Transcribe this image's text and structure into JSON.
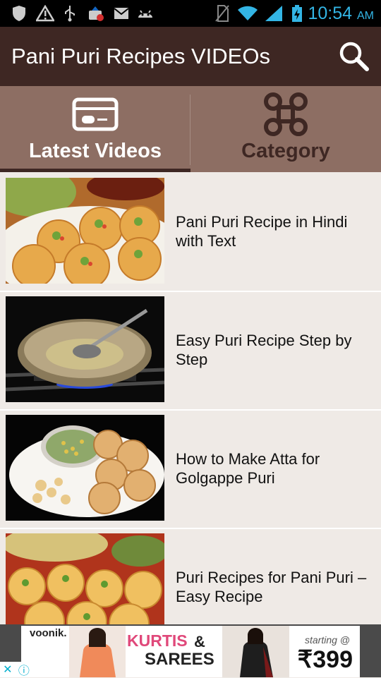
{
  "status_bar": {
    "icons": [
      "shield-icon",
      "warning-icon",
      "usb-icon",
      "app-update-icon",
      "mail-icon",
      "android-icon",
      "no-sim-icon",
      "wifi-icon",
      "signal-icon",
      "battery-charging-icon"
    ],
    "time": "10:54",
    "ampm": "AM",
    "time_color": "#33b5e5"
  },
  "app_bar": {
    "title": "Pani Puri Recipes VIDEOs",
    "background": "#3e2723",
    "search_icon": "search-icon"
  },
  "tabs": [
    {
      "label": "Latest Videos",
      "icon": "video-card-icon",
      "selected": true,
      "color": "#ffffff"
    },
    {
      "label": "Category",
      "icon": "command-icon",
      "selected": false,
      "color": "#3e2723"
    }
  ],
  "videos": [
    {
      "title": "Pani Puri Recipe in Hindi with Text",
      "thumb": "pani-puri-plate-thumbnail"
    },
    {
      "title": "Easy Puri Recipe Step by Step",
      "thumb": "frying-pan-thumbnail"
    },
    {
      "title": "How to Make Atta for Golgappe Puri",
      "thumb": "golgappe-plate-thumbnail"
    },
    {
      "title": "Puri Recipes for Pani Puri – Easy Recipe",
      "thumb": "stuffed-puri-thumbnail"
    }
  ],
  "ad": {
    "brand": "voonik.",
    "headline_1": "KURTIS",
    "headline_amp": "&",
    "headline_2": "SAREES",
    "price_prefix": "starting @",
    "price": "₹399"
  }
}
